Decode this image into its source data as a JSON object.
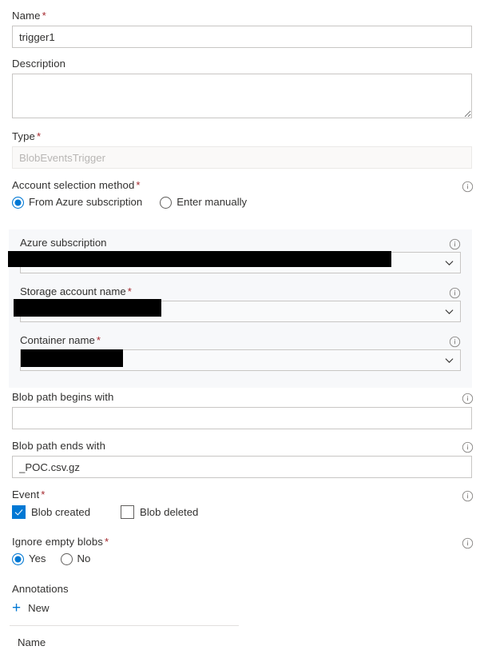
{
  "form": {
    "name": {
      "label": "Name",
      "required": "*",
      "value": "trigger1"
    },
    "description": {
      "label": "Description",
      "value": ""
    },
    "type": {
      "label": "Type",
      "required": "*",
      "value": "BlobEventsTrigger",
      "disabled": true
    },
    "account_selection": {
      "label": "Account selection method",
      "required": "*",
      "options": [
        {
          "label": "From Azure subscription",
          "selected": true
        },
        {
          "label": "Enter manually",
          "selected": false
        }
      ]
    },
    "azure_subscription": {
      "label": "Azure subscription",
      "value": "",
      "redacted": true
    },
    "storage_account_name": {
      "label": "Storage account name",
      "required": "*",
      "value": "",
      "redacted": true
    },
    "container_name": {
      "label": "Container name",
      "required": "*",
      "value": "",
      "redacted": true
    },
    "blob_path_begins_with": {
      "label": "Blob path begins with",
      "value": ""
    },
    "blob_path_ends_with": {
      "label": "Blob path ends with",
      "value": "_POC.csv.gz"
    },
    "event": {
      "label": "Event",
      "required": "*",
      "options": [
        {
          "label": "Blob created",
          "checked": true
        },
        {
          "label": "Blob deleted",
          "checked": false
        }
      ]
    },
    "ignore_empty_blobs": {
      "label": "Ignore empty blobs",
      "required": "*",
      "options": [
        {
          "label": "Yes",
          "selected": true
        },
        {
          "label": "No",
          "selected": false
        }
      ]
    },
    "annotations": {
      "label": "Annotations",
      "new_label": "New",
      "column_header": "Name"
    }
  },
  "colors": {
    "accent": "#0078d4",
    "required_star": "#a4262c",
    "text": "#323130",
    "border": "#c8c6c4",
    "panel_bg": "#f7f8fa",
    "disabled_text": "#b8b6b4"
  }
}
